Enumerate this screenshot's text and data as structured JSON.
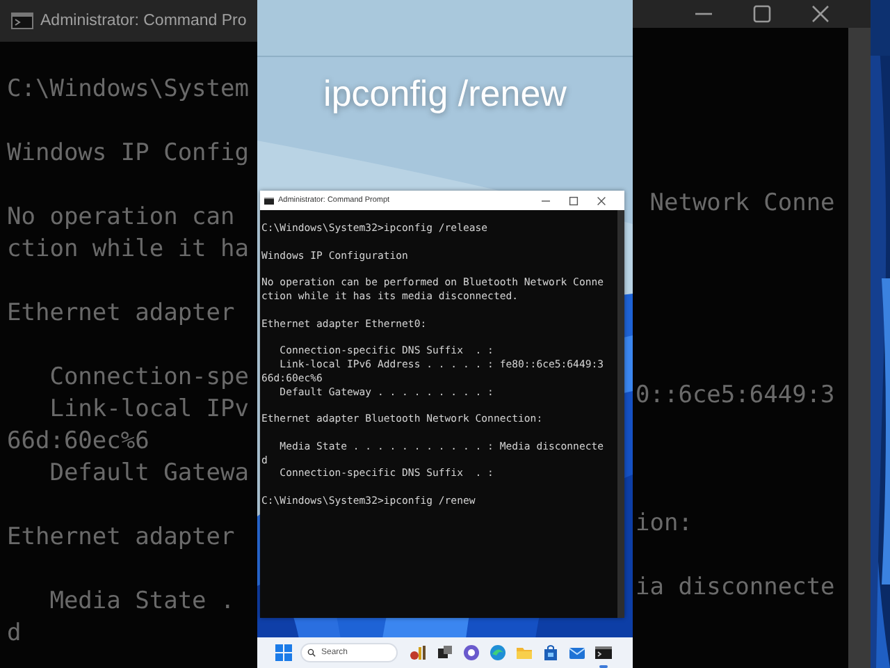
{
  "background_console": {
    "title": "Administrator: Command Pro",
    "blocks": [
      [
        {
          "left": "C:\\Windows\\System"
        }
      ],
      [
        {
          "left": "Windows IP Config"
        }
      ],
      [
        {
          "left": "No operation can",
          "right": " Network Conne"
        },
        {
          "left": "ction while it ha"
        }
      ],
      [
        {
          "left": "Ethernet adapter"
        }
      ],
      [
        {
          "left": "   Connection-spe"
        },
        {
          "left": "   Link-local IPv",
          "right": "0::6ce5:6449:3"
        },
        {
          "left": "66d:60ec%6"
        },
        {
          "left": "   Default Gatewa"
        }
      ],
      [
        {
          "left": "Ethernet adapter",
          "right": "ion:"
        }
      ],
      [
        {
          "left": "   Media State .",
          "right": "ia disconnecte"
        },
        {
          "left": "d"
        }
      ]
    ]
  },
  "video": {
    "caption": "ipconfig /renew",
    "console": {
      "title": "Administrator: Command Prompt",
      "blocks": [
        [
          "C:\\Windows\\System32>ipconfig /release"
        ],
        [
          "Windows IP Configuration"
        ],
        [
          "No operation can be performed on Bluetooth Network Conne",
          "ction while it has its media disconnected."
        ],
        [
          "Ethernet adapter Ethernet0:"
        ],
        [
          "   Connection-specific DNS Suffix  . :",
          "   Link-local IPv6 Address . . . . . : fe80::6ce5:6449:3",
          "66d:60ec%6",
          "   Default Gateway . . . . . . . . . :"
        ],
        [
          "Ethernet adapter Bluetooth Network Connection:"
        ],
        [
          "   Media State . . . . . . . . . . . : Media disconnecte",
          "d",
          "   Connection-specific DNS Suffix  . :"
        ],
        [
          "C:\\Windows\\System32>ipconfig /renew"
        ]
      ]
    },
    "taskbar": {
      "search": {
        "placeholder": "Search"
      },
      "apps": [
        {
          "kind": "start",
          "active": false
        },
        {
          "kind": "search"
        },
        {
          "kind": "widget",
          "active": false
        },
        {
          "kind": "taskview",
          "active": false
        },
        {
          "kind": "chat",
          "active": false
        },
        {
          "kind": "browser",
          "active": false
        },
        {
          "kind": "folder",
          "active": false
        },
        {
          "kind": "store",
          "active": false
        },
        {
          "kind": "mail",
          "active": false
        },
        {
          "kind": "terminal",
          "active": true
        }
      ]
    }
  }
}
